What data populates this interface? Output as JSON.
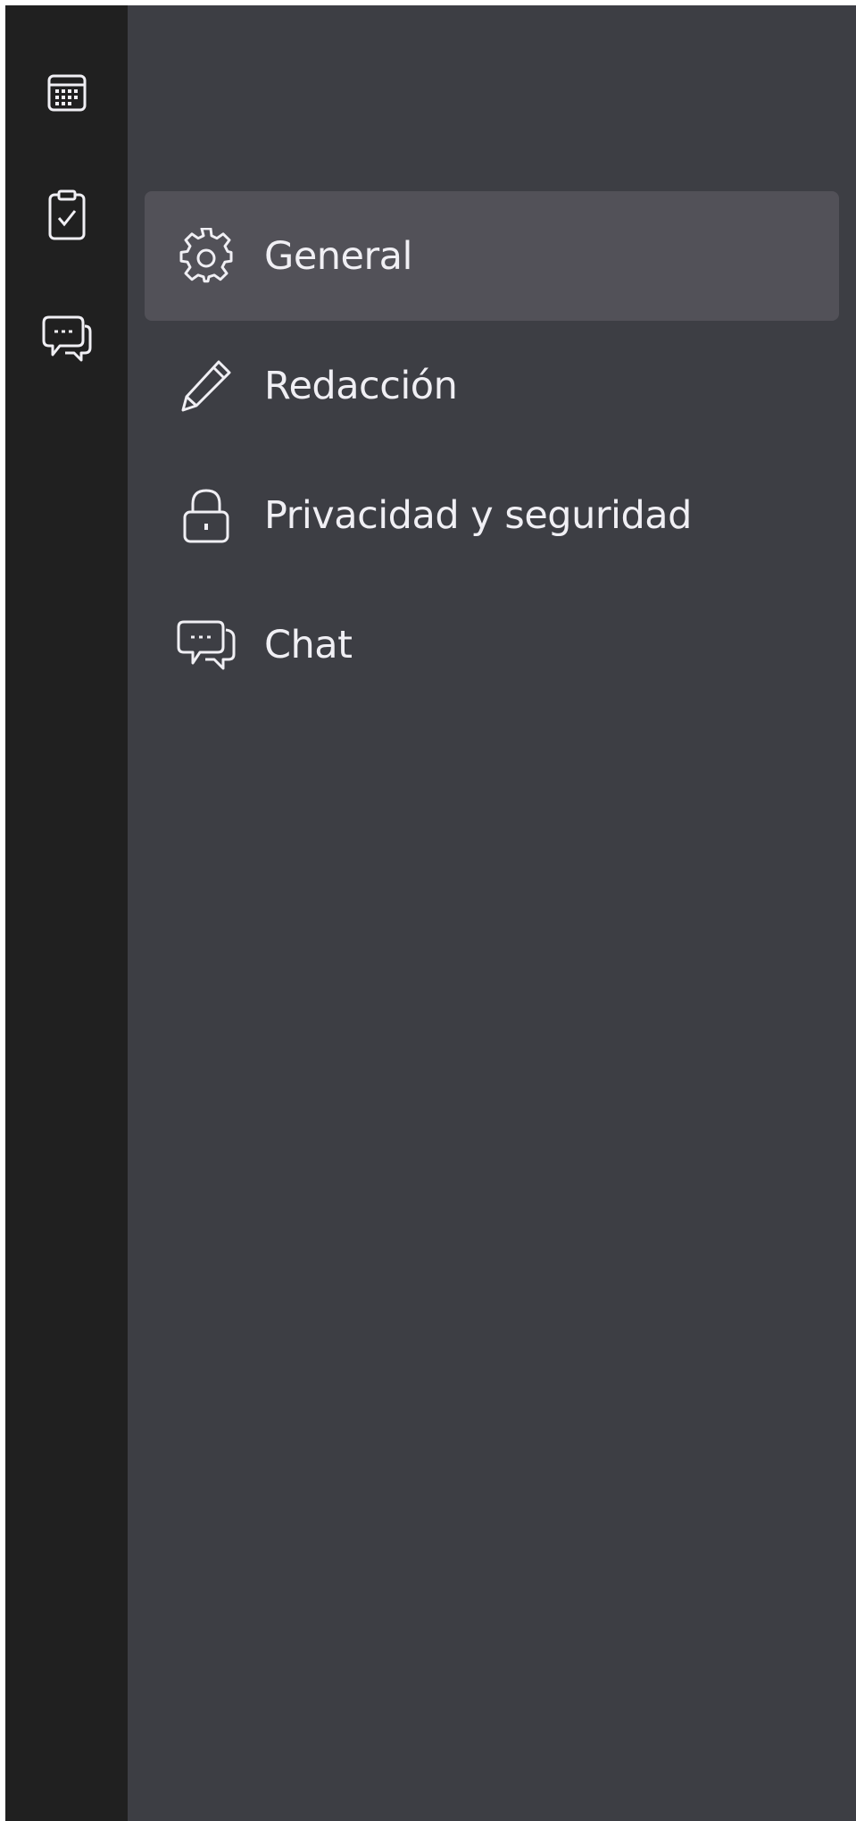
{
  "spaces_bar": {
    "items": [
      {
        "name": "calendar",
        "icon": "calendar-icon"
      },
      {
        "name": "tasks",
        "icon": "clipboard-check-icon"
      },
      {
        "name": "chat",
        "icon": "chat-bubbles-icon"
      }
    ]
  },
  "settings": {
    "categories": [
      {
        "label": "General",
        "icon": "gear-icon",
        "selected": true
      },
      {
        "label": "Redacción",
        "icon": "pencil-icon",
        "selected": false
      },
      {
        "label": "Privacidad y seguridad",
        "icon": "lock-icon",
        "selected": false
      },
      {
        "label": "Chat",
        "icon": "chat-bubbles-icon",
        "selected": false
      }
    ]
  },
  "colors": {
    "spaces_bar_bg": "#202020",
    "pane_bg": "#3d3e44",
    "selected_bg": "#525158",
    "text": "#f0eff4",
    "icon": "#f0eff4"
  }
}
